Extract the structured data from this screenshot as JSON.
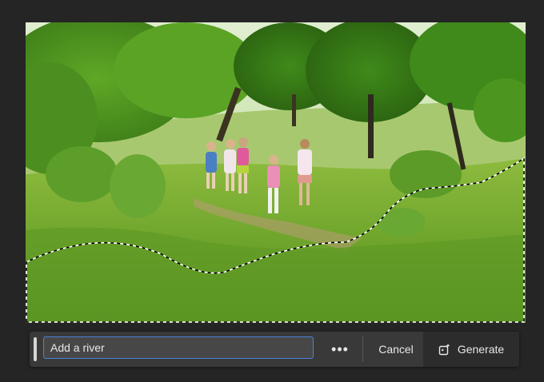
{
  "prompt": {
    "value": "Add a river"
  },
  "actions": {
    "more_label": "•••",
    "cancel_label": "Cancel",
    "generate_label": "Generate"
  },
  "icons": {
    "generate": "generative-fill-icon",
    "more": "more-options-icon"
  },
  "colors": {
    "background": "#252525",
    "taskbar": "#393939",
    "input_border": "#4b82d8"
  }
}
